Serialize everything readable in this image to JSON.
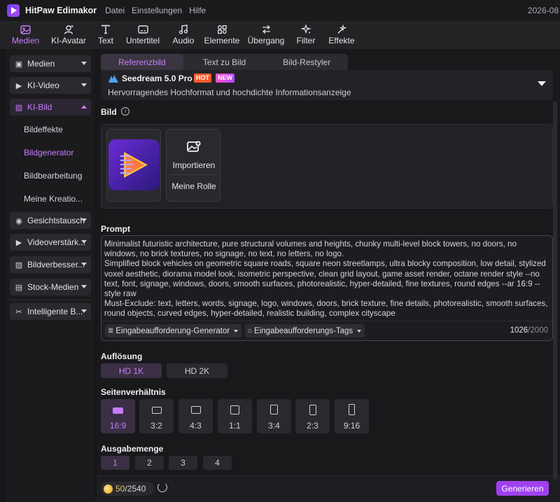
{
  "app": {
    "name": "HitPaw Edimakor",
    "menu": [
      "Datei",
      "Einstellungen",
      "Hilfe"
    ],
    "date": "2026-08"
  },
  "toolbar": {
    "items": [
      {
        "label": "Medien",
        "icon": "media-icon",
        "active": true
      },
      {
        "label": "KI-Avatar",
        "icon": "avatar-icon"
      },
      {
        "label": "Text",
        "icon": "text-icon"
      },
      {
        "label": "Untertitel",
        "icon": "subtitle-icon"
      },
      {
        "label": "Audio",
        "icon": "audio-icon"
      },
      {
        "label": "Elemente",
        "icon": "elements-icon"
      },
      {
        "label": "Übergang",
        "icon": "transition-icon"
      },
      {
        "label": "Filter",
        "icon": "filter-icon"
      },
      {
        "label": "Effekte",
        "icon": "effects-icon"
      }
    ]
  },
  "sidebar": {
    "groups": [
      {
        "label": "Medien",
        "icon": "media-icon"
      },
      {
        "label": "KI-Video",
        "icon": "video-icon"
      },
      {
        "label": "KI-Bild",
        "icon": "image-icon",
        "active": true,
        "expanded": true
      }
    ],
    "sub_items": [
      {
        "label": "Bildeffekte"
      },
      {
        "label": "Bildgenerator",
        "active": true
      },
      {
        "label": "Bildbearbeitung"
      },
      {
        "label": "Meine Kreatio..."
      }
    ],
    "more_groups": [
      {
        "label": "Gesichtstausch",
        "icon": "face-swap-icon"
      },
      {
        "label": "Videoverstärk...",
        "icon": "video-enhance-icon"
      },
      {
        "label": "Bildverbesser...",
        "icon": "image-enhance-icon"
      },
      {
        "label": "Stock-Medien",
        "icon": "stock-media-icon"
      },
      {
        "label": "Intelligente B...",
        "icon": "smart-tools-icon"
      }
    ]
  },
  "main": {
    "tabs": [
      {
        "label": "Referenzbild",
        "active": true
      },
      {
        "label": "Text zu Bild"
      },
      {
        "label": "Bild-Restyler"
      }
    ],
    "model": {
      "name": "Seedream 5.0 Pro",
      "badge_hot": "HOT",
      "badge_new": "NEW",
      "description": "Hervorragendes Hochformat und hochdichte Informationsanzeige"
    },
    "image_section": {
      "label": "Bild",
      "import_label": "Importieren",
      "role_label": "Meine Rolle"
    },
    "prompt": {
      "label": "Prompt",
      "text": "Minimalist futuristic architecture, pure structural volumes and heights, chunky multi-level block towers, no doors, no windows, no brick textures, no signage, no text, no letters, no logo.\nSimplified block vehicles on geometric square roads, square neon streetlamps, ultra blocky composition, low detail, stylized voxel aesthetic, diorama model look, isometric perspective, clean grid layout, game asset render, octane render style --no text, font, signage, windows, doors, smooth surfaces, photorealistic, hyper-detailed, fine textures, round edges --ar 16:9 --style raw\nMust-Exclude: text, letters, words, signage, logo, windows, doors, brick texture, fine details, photorealistic, smooth surfaces, round objects, curved edges, hyper-detailed, realistic building, complex cityscape",
      "generator_label": "Eingabeaufforderung-Generator",
      "tags_label": "Eingabeaufforderungs-Tags",
      "count": "1026",
      "max": "/2000"
    },
    "resolution": {
      "label": "Auflösung",
      "options": [
        {
          "label": "HD 1K",
          "active": true
        },
        {
          "label": "HD 2K"
        }
      ]
    },
    "aspect_ratio": {
      "label": "Seitenverhältnis",
      "options": [
        {
          "label": "16:9",
          "active": true
        },
        {
          "label": "3:2"
        },
        {
          "label": "4:3"
        },
        {
          "label": "1:1"
        },
        {
          "label": "3:4"
        },
        {
          "label": "2:3"
        },
        {
          "label": "9:16"
        }
      ]
    },
    "quantity": {
      "label": "Ausgabemenge",
      "options": [
        {
          "label": "1",
          "active": true
        },
        {
          "label": "2"
        },
        {
          "label": "3"
        },
        {
          "label": "4"
        }
      ]
    },
    "footer": {
      "credits_current": "50",
      "credits_total": "/2540",
      "generate_label": "Generieren"
    }
  },
  "colors": {
    "accent": "#c77dff",
    "generate_button": "#a040f0",
    "badge_hot": "#ff5a2c"
  }
}
